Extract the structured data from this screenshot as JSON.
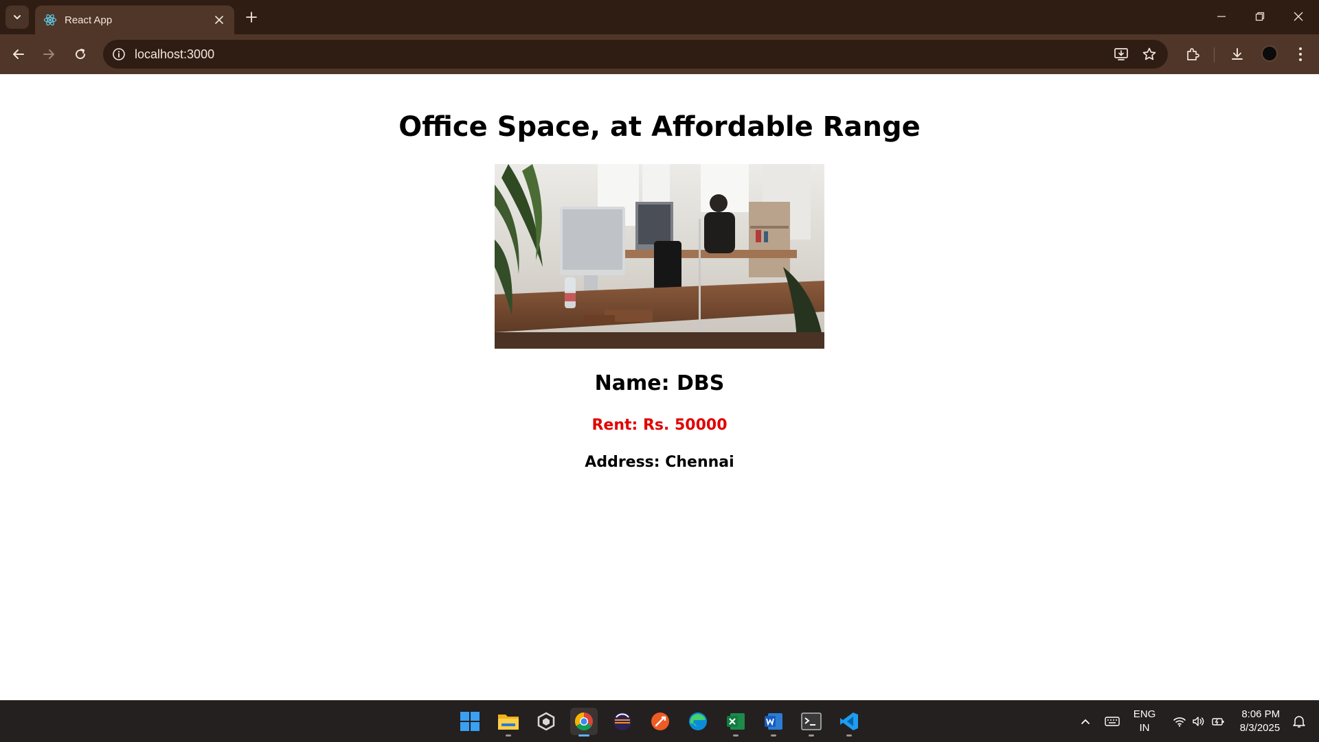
{
  "browser": {
    "tab": {
      "title": "React App"
    },
    "address_bar": {
      "url": "localhost:3000"
    }
  },
  "page": {
    "heading": "Office Space, at Affordable Range",
    "image": {
      "subject": "office-workspace-photo"
    },
    "name": "Name: DBS",
    "rent": "Rent: Rs. 50000",
    "address": "Address: Chennai",
    "colors": {
      "rent": "#e10000",
      "text": "#000000"
    }
  },
  "taskbar": {
    "apps": [
      "windows-start",
      "file-explorer",
      "unity-hub",
      "chrome",
      "eclipse",
      "postman",
      "edge",
      "excel",
      "word",
      "terminal",
      "vscode"
    ],
    "tray": {
      "language": "ENG",
      "region": "IN",
      "time": "8:06 PM",
      "date": "8/3/2025"
    }
  },
  "colors": {
    "chrome_dark": "#2f1d13",
    "chrome_light": "#4f3628",
    "taskbar": "#24201f"
  }
}
